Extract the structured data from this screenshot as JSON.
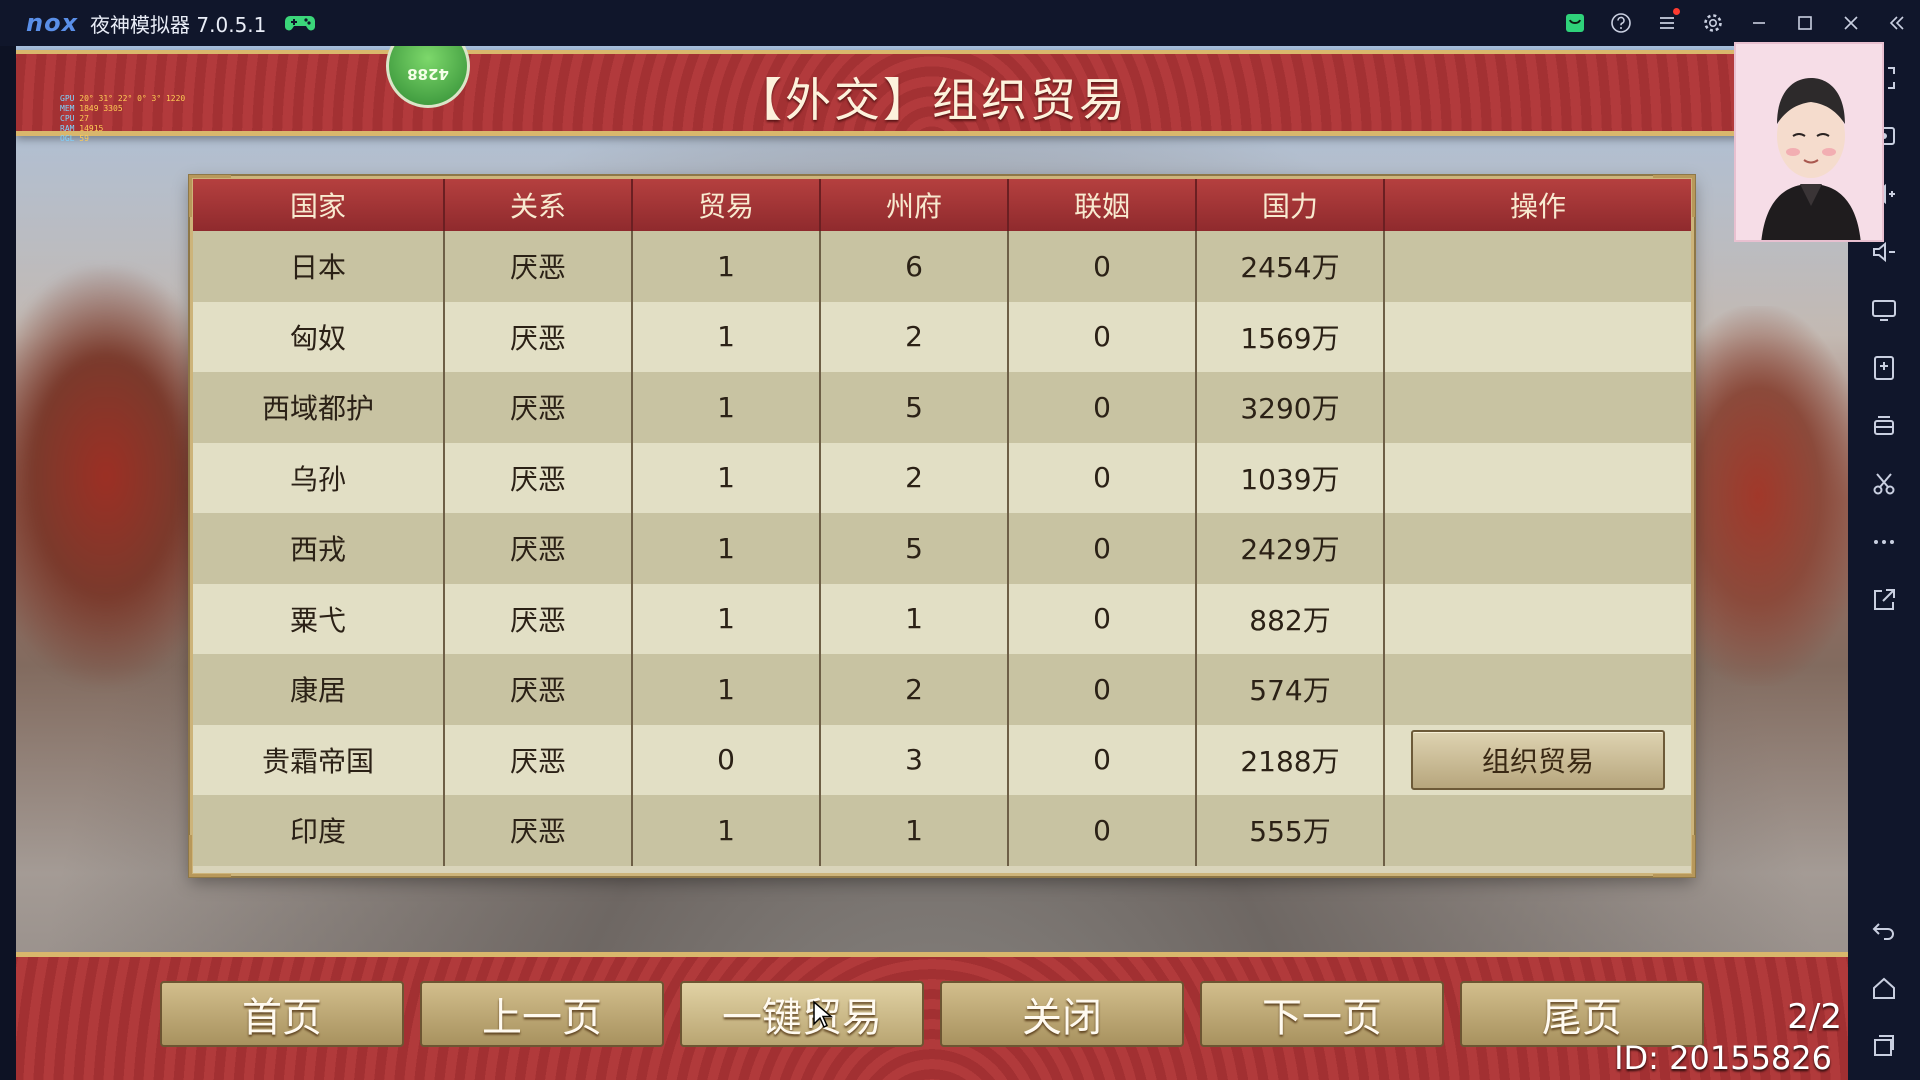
{
  "emulator": {
    "logo_text": "nox",
    "title": "夜神模拟器 7.0.5.1"
  },
  "game": {
    "banner_title": "【外交】组织贸易",
    "badge_value": "4288",
    "perf_overlay": [
      {
        "key": "GPU",
        "text": "20° 31° 22° 0° 3° 1220"
      },
      {
        "key": "MEM",
        "text": "1849 3305"
      },
      {
        "key": "CPU",
        "text": "27"
      },
      {
        "key": "RAM",
        "text": "14915"
      },
      {
        "key": "OGL",
        "text": "59"
      }
    ]
  },
  "table": {
    "headers": [
      "国家",
      "关系",
      "贸易",
      "州府",
      "联姻",
      "国力",
      "操作"
    ],
    "rows": [
      {
        "country": "日本",
        "relation": "厌恶",
        "trade": "1",
        "prefectures": "6",
        "marriage": "0",
        "power": "2454万",
        "action": ""
      },
      {
        "country": "匈奴",
        "relation": "厌恶",
        "trade": "1",
        "prefectures": "2",
        "marriage": "0",
        "power": "1569万",
        "action": ""
      },
      {
        "country": "西域都护",
        "relation": "厌恶",
        "trade": "1",
        "prefectures": "5",
        "marriage": "0",
        "power": "3290万",
        "action": ""
      },
      {
        "country": "乌孙",
        "relation": "厌恶",
        "trade": "1",
        "prefectures": "2",
        "marriage": "0",
        "power": "1039万",
        "action": ""
      },
      {
        "country": "西戎",
        "relation": "厌恶",
        "trade": "1",
        "prefectures": "5",
        "marriage": "0",
        "power": "2429万",
        "action": ""
      },
      {
        "country": "粟弋",
        "relation": "厌恶",
        "trade": "1",
        "prefectures": "1",
        "marriage": "0",
        "power": "882万",
        "action": ""
      },
      {
        "country": "康居",
        "relation": "厌恶",
        "trade": "1",
        "prefectures": "2",
        "marriage": "0",
        "power": "574万",
        "action": ""
      },
      {
        "country": "贵霜帝国",
        "relation": "厌恶",
        "trade": "0",
        "prefectures": "3",
        "marriage": "0",
        "power": "2188万",
        "action": "组织贸易"
      },
      {
        "country": "印度",
        "relation": "厌恶",
        "trade": "1",
        "prefectures": "1",
        "marriage": "0",
        "power": "555万",
        "action": ""
      }
    ]
  },
  "bottom_nav": {
    "buttons": [
      "首页",
      "上一页",
      "一键贸易",
      "关闭",
      "下一页",
      "尾页"
    ],
    "page_indicator": "2/2",
    "user_id": "ID: 20155826"
  },
  "colors": {
    "banner_red": "#a93537",
    "gold_border": "#d9b76c",
    "header_red": "#b5403f",
    "row_dark": "#c8c3a2",
    "row_light": "#e2dfc5",
    "emulator_bg": "#10162b"
  },
  "icons": {
    "titlebar": [
      "gamepad-icon",
      "store-icon",
      "help-icon",
      "menu-icon",
      "settings-icon",
      "minimize-icon",
      "maximize-icon",
      "close-icon",
      "collapse-sidebar-icon"
    ],
    "sidebar": [
      "fullscreen-icon",
      "screenshot-icon",
      "volume-up-icon",
      "volume-down-icon",
      "screen-icon",
      "apk-install-icon",
      "multi-instance-icon",
      "scissors-icon",
      "more-icon",
      "share-icon",
      "back-icon",
      "home-icon",
      "recent-apps-icon"
    ]
  }
}
